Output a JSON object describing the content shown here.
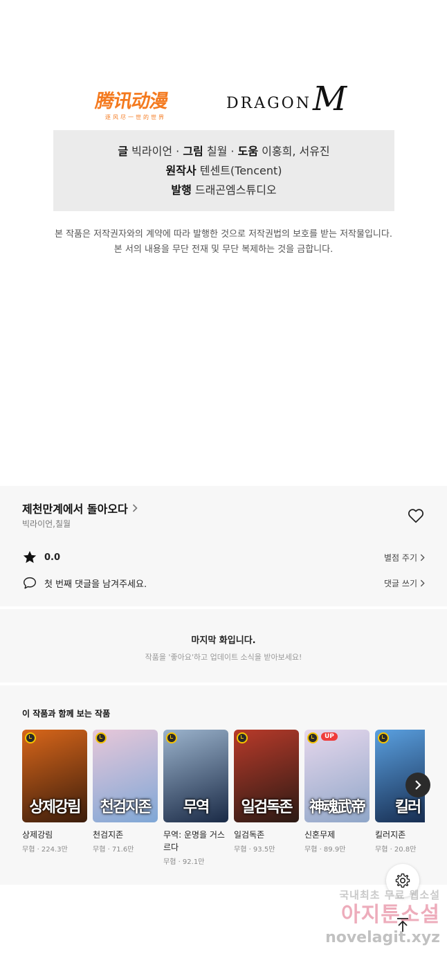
{
  "logos": {
    "tencent_main": "腾讯动漫",
    "tencent_sub": "逐风尽一世的世界",
    "dragon_text": "DRAGON",
    "dragon_m": "M"
  },
  "credits": {
    "writer_label": "글",
    "writer": "빅라이언",
    "artist_label": "그림",
    "artist": "칠월",
    "assist_label": "도움",
    "assist": "이홍희, 서유진",
    "original_label": "원작사",
    "original": "텐센트(Tencent)",
    "publisher_label": "발행",
    "publisher": "드래곤엠스튜디오",
    "sep": "·"
  },
  "notice": {
    "line1": "본 작품은 저작권자와의 계약에 따라 발행한 것으로 저작권법의 보호를 받는 저작물입니다.",
    "line2": "본 서의 내용을 무단 전재 및 무단 복제하는 것을 금합니다."
  },
  "series": {
    "title": "제천만계에서 돌아오다",
    "authors": "빅라이언,칠월",
    "rating": "0.0",
    "rate_label": "별점 주기",
    "comment_prompt": "첫 번째 댓글을 남겨주세요.",
    "comment_label": "댓글 쓰기"
  },
  "last_episode": {
    "title": "마지막 화입니다.",
    "subtitle": "작품을 '좋아요'하고 업데이트 소식을 받아보세요!"
  },
  "recommend": {
    "heading": "이 작품과 함께 보는 작품",
    "items": [
      {
        "name": "상제강림",
        "meta": "무협 · 224.3만",
        "cover_text": "상제강림",
        "up": "",
        "c1": "#3b1d0c",
        "c2": "#d8661a"
      },
      {
        "name": "천검지존",
        "meta": "무협 · 71.6만",
        "cover_text": "천검지존",
        "up": "",
        "c1": "#7fa7d6",
        "c2": "#e7c7d9"
      },
      {
        "name": "무역: 운명을 거스르다",
        "meta": "무협 · 92.1만",
        "cover_text": "무역",
        "up": "",
        "c1": "#1a2a46",
        "c2": "#9bb3cc"
      },
      {
        "name": "일검독존",
        "meta": "무협 · 93.5만",
        "cover_text": "일검독존",
        "up": "",
        "c1": "#2b1a14",
        "c2": "#b83a2a"
      },
      {
        "name": "신혼무제",
        "meta": "무협 · 89.9만",
        "cover_text": "神魂武帝",
        "up": "UP",
        "c1": "#8fa6c8",
        "c2": "#e6d7ec"
      },
      {
        "name": "킬러지존",
        "meta": "무협 · 20.8만",
        "cover_text": "킬러",
        "up": "",
        "c1": "#14284a",
        "c2": "#5aa0e0"
      }
    ]
  },
  "watermark": {
    "line1": "국내최초 무료 웹소설",
    "line2": "아지툰소설",
    "line3": "novelagit.xyz"
  }
}
